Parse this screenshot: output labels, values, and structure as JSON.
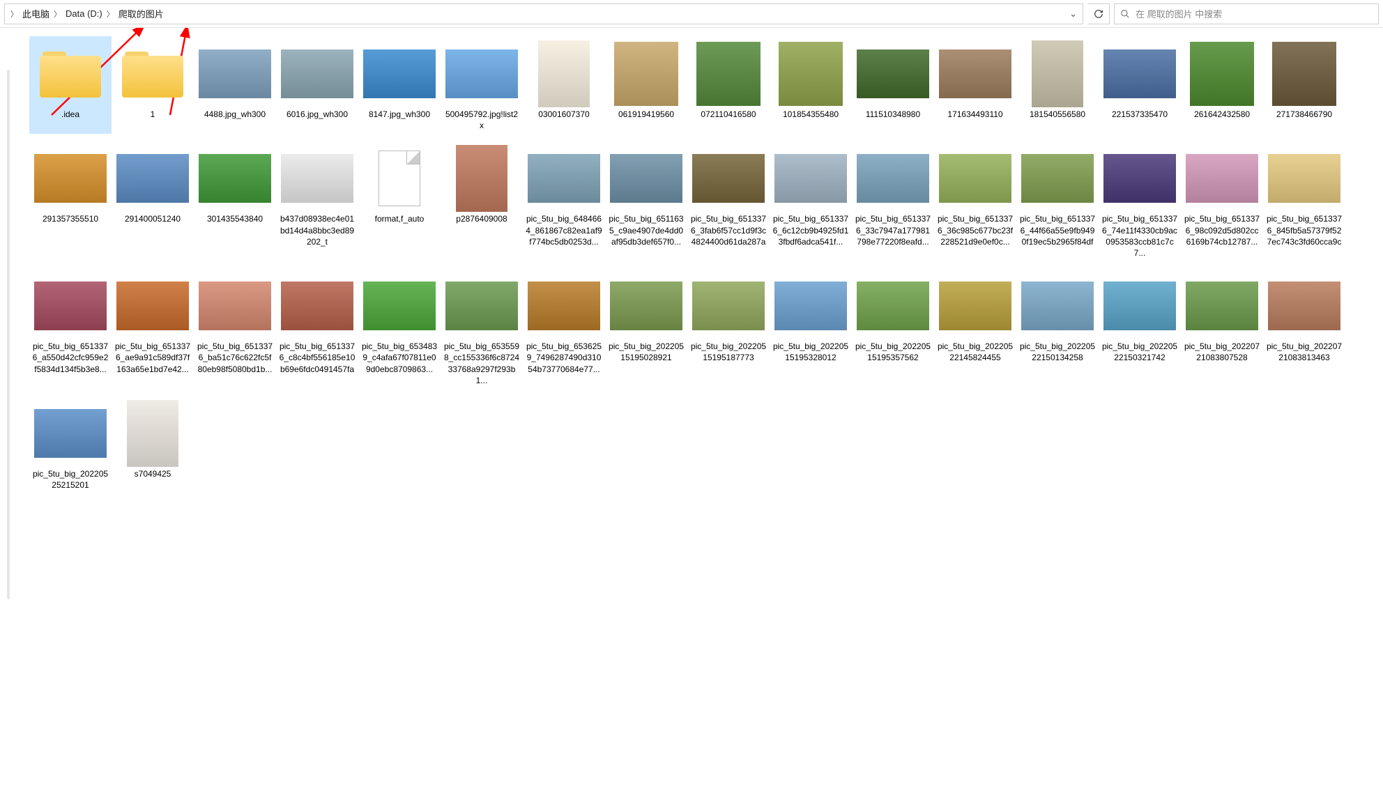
{
  "breadcrumb": {
    "items": [
      "此电脑",
      "Data (D:)",
      "爬取的图片"
    ]
  },
  "search": {
    "placeholder": "在 爬取的图片 中搜索"
  },
  "items": [
    {
      "name": ".idea",
      "type": "folder",
      "selected": true
    },
    {
      "name": "1",
      "type": "folder"
    },
    {
      "name": "4488.jpg_wh300",
      "type": "image",
      "c": "#7ea0be"
    },
    {
      "name": "6016.jpg_wh300",
      "type": "image",
      "c": "#8aa6b2"
    },
    {
      "name": "8147.jpg_wh300",
      "type": "image",
      "c": "#3b8bcf"
    },
    {
      "name": "500495792.jpg!list2x",
      "type": "image",
      "c": "#66a8e6"
    },
    {
      "name": "03001607370",
      "type": "image",
      "c": "#f4eedd",
      "tall": true
    },
    {
      "name": "061919419560",
      "type": "image",
      "sq": true,
      "c": "#c8a86b"
    },
    {
      "name": "072110416580",
      "type": "image",
      "sq": true,
      "c": "#548a3a"
    },
    {
      "name": "101854355480",
      "type": "image",
      "sq": true,
      "c": "#8fa24a"
    },
    {
      "name": "111510348980",
      "type": "image",
      "c": "#3f6a2b"
    },
    {
      "name": "171634493110",
      "type": "image",
      "c": "#9c7c5c"
    },
    {
      "name": "181540556580",
      "type": "image",
      "tall": true,
      "c": "#c7c2a9"
    },
    {
      "name": "221537335470",
      "type": "image",
      "c": "#4b6fa3"
    },
    {
      "name": "261642432580",
      "type": "image",
      "sq": true,
      "c": "#4c8a2e"
    },
    {
      "name": "271738466790",
      "type": "image",
      "sq": true,
      "c": "#6c5a3a"
    },
    {
      "name": "291357355510",
      "type": "image",
      "c": "#d6902a"
    },
    {
      "name": "291400051240",
      "type": "image",
      "c": "#5b8cc3"
    },
    {
      "name": "301435543840",
      "type": "image",
      "c": "#3f9a37"
    },
    {
      "name": "b437d08938ec4e01bd14d4a8bbc3ed89202_t",
      "type": "image",
      "c": "#e8e8e8"
    },
    {
      "name": "format,f_auto",
      "type": "doc"
    },
    {
      "name": "p2876409008",
      "type": "image",
      "tall": true,
      "c": "#c0795d"
    },
    {
      "name": "pic_5tu_big_6484664_861867c82ea1af9f774bc5db0253d...",
      "type": "image",
      "c": "#7ea2b6"
    },
    {
      "name": "pic_5tu_big_6511635_c9ae4907de4dd0af95db3def657f0...",
      "type": "image",
      "c": "#6d8fa6"
    },
    {
      "name": "pic_5tu_big_6513376_3fab6f57cc1d9f3c4824400d61da287a",
      "type": "image",
      "c": "#76653a"
    },
    {
      "name": "pic_5tu_big_6513376_6c12cb9b4925fd13fbdf6adca541f...",
      "type": "image",
      "c": "#9fb2c2"
    },
    {
      "name": "pic_5tu_big_6513376_33c7947a177981798e77220f8eafd...",
      "type": "image",
      "c": "#7aa2bc"
    },
    {
      "name": "pic_5tu_big_6513376_36c985c677bc23f228521d9e0ef0c...",
      "type": "image",
      "c": "#95b15a"
    },
    {
      "name": "pic_5tu_big_6513376_44f66a55e9fb9490f19ec5b2965f84df",
      "type": "image",
      "c": "#7f9e4e"
    },
    {
      "name": "pic_5tu_big_6513376_74e11f4330cb9ac0953583ccb81c7c7...",
      "type": "image",
      "c": "#4a3a7a"
    },
    {
      "name": "pic_5tu_big_6513376_98c092d5d802cc6169b74cb12787...",
      "type": "image",
      "c": "#d297b8"
    },
    {
      "name": "pic_5tu_big_6513376_845fb5a57379f527ec743c3fd60cca9c",
      "type": "image",
      "c": "#e5c880"
    },
    {
      "name": "pic_5tu_big_6513376_a550d42cfc959e2f5834d134f5b3e8...",
      "type": "image",
      "c": "#a54a5e"
    },
    {
      "name": "pic_5tu_big_6513376_ae9a91c589df37f163a65e1bd7e42...",
      "type": "image",
      "c": "#c86a2a"
    },
    {
      "name": "pic_5tu_big_6513376_ba51c76c622fc5f80eb98f5080bd1b...",
      "type": "image",
      "c": "#d4876e"
    },
    {
      "name": "pic_5tu_big_6513376_c8c4bf556185e10b69e6fdc0491457fa",
      "type": "image",
      "c": "#b5604a"
    },
    {
      "name": "pic_5tu_big_6534839_c4afa67f07811e09d0ebc8709863...",
      "type": "image",
      "c": "#4aa83a"
    },
    {
      "name": "pic_5tu_big_6535598_cc155336f6c872433768a9297f293b1...",
      "type": "image",
      "c": "#6b9a50"
    },
    {
      "name": "pic_5tu_big_6536259_7496287490d31054b73770684e77...",
      "type": "image",
      "c": "#b87c2a"
    },
    {
      "name": "pic_5tu_big_20220515195028921",
      "type": "image",
      "c": "#7a9a4e"
    },
    {
      "name": "pic_5tu_big_20220515195187773",
      "type": "image",
      "c": "#90a75b"
    },
    {
      "name": "pic_5tu_big_20220515195328012",
      "type": "image",
      "c": "#6ba0d0"
    },
    {
      "name": "pic_5tu_big_20220515195357562",
      "type": "image",
      "c": "#6fa24a"
    },
    {
      "name": "pic_5tu_big_20220522145824455",
      "type": "image",
      "c": "#b8a03a"
    },
    {
      "name": "pic_5tu_big_20220522150134258",
      "type": "image",
      "c": "#7aa8c8"
    },
    {
      "name": "pic_5tu_big_20220522150321742",
      "type": "image",
      "c": "#58a3c8"
    },
    {
      "name": "pic_5tu_big_20220721083807528",
      "type": "image",
      "c": "#6a9a4a"
    },
    {
      "name": "pic_5tu_big_20220721083813463",
      "type": "image",
      "c": "#b87c5c"
    },
    {
      "name": "pic_5tu_big_20220525215201",
      "type": "image",
      "c": "#5a8fc8"
    },
    {
      "name": "s7049425",
      "type": "image",
      "tall": true,
      "c": "#ece8e0"
    }
  ]
}
